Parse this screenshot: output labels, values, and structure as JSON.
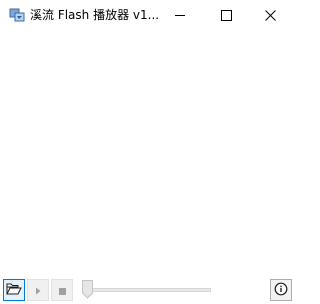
{
  "window": {
    "title": "溪流 Flash 播放器 v1...",
    "app_icon": "flash-player-app-icon",
    "controls": {
      "minimize_icon": "minimize-icon",
      "maximize_icon": "maximize-icon",
      "close_icon": "close-icon"
    }
  },
  "toolbar": {
    "open_icon": "folder-open-icon",
    "play_icon": "play-icon",
    "stop_icon": "stop-icon",
    "info_icon": "info-icon",
    "seek_position": 0
  },
  "colors": {
    "accent": "#0078d7",
    "button_disabled_glyph": "#a0a0a0"
  }
}
